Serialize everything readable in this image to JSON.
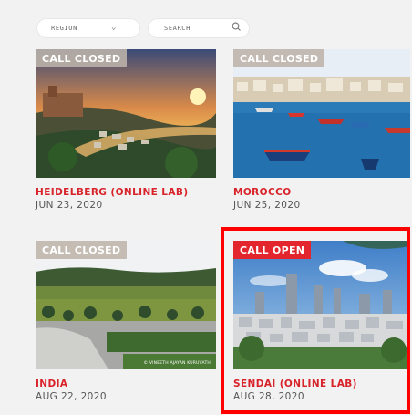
{
  "filters": {
    "region_label": "REGION",
    "search_placeholder": "SEARCH"
  },
  "cards": [
    {
      "badge": "CALL CLOSED",
      "name": "HEIDELBERG (ONLINE LAB)",
      "date": "JUN 23, 2020",
      "status": "closed"
    },
    {
      "badge": "CALL CLOSED",
      "name": "MOROCCO",
      "date": "JUN 25, 2020",
      "status": "closed"
    },
    {
      "badge": "CALL CLOSED",
      "name": "INDIA",
      "date": "AUG 22, 2020",
      "status": "closed",
      "photo_credit": "© VINEETH AJAYAN KURUVATH"
    },
    {
      "badge": "CALL OPEN",
      "name": "SENDAI (ONLINE LAB)",
      "date": "AUG 28, 2020",
      "status": "open"
    }
  ],
  "colors": {
    "accent_red": "#d8232a",
    "open_badge": "#e3262d",
    "closed_badge": "#beb4aa",
    "highlight": "#ff0000"
  },
  "icons": {
    "region_dropdown": "chevron-down-icon",
    "search": "search-icon"
  }
}
